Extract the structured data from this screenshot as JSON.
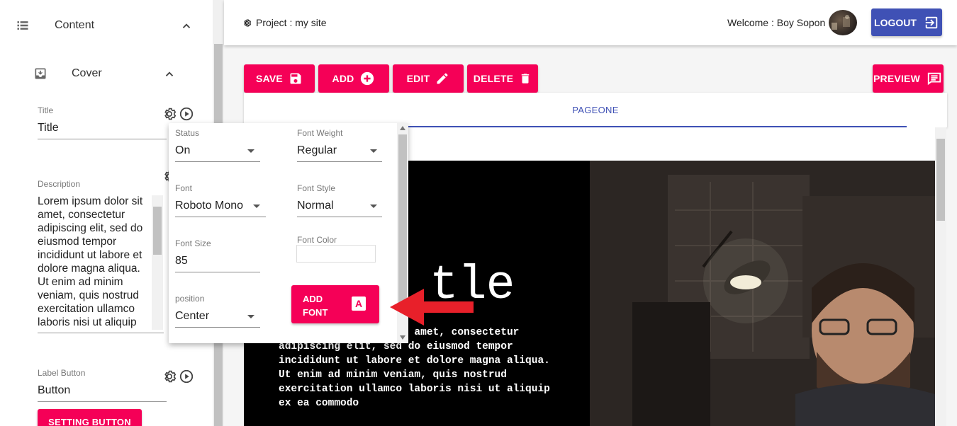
{
  "header": {
    "project_label": "Project : my site",
    "welcome_label": "Welcome : Boy Sopon",
    "logout_label": "LOGOUT"
  },
  "sidebar": {
    "content_label": "Content",
    "cover_label": "Cover",
    "title_field": {
      "label": "Title",
      "value": "Title"
    },
    "description_field": {
      "label": "Description",
      "value": "Lorem ipsum dolor sit amet, consectetur adipiscing elit, sed do eiusmod tempor incididunt ut labore et dolore magna aliqua. Ut enim ad minim veniam, quis nostrud exercitation ullamco laboris nisi ut aliquip"
    },
    "button_field": {
      "label": "Label Button",
      "value": "Button"
    },
    "setting_button_label": "SETTING BUTTON"
  },
  "toolbar": {
    "save_label": "SAVE",
    "add_label": "ADD",
    "edit_label": "EDIT",
    "delete_label": "DELETE",
    "preview_label": "PREVIEW"
  },
  "tabs": [
    {
      "label": "PAGEONE"
    }
  ],
  "font_popup": {
    "status": {
      "label": "Status",
      "value": "On"
    },
    "font_weight": {
      "label": "Font Weight",
      "value": "Regular"
    },
    "font": {
      "label": "Font",
      "value": "Roboto Mono"
    },
    "font_style": {
      "label": "Font Style",
      "value": "Normal"
    },
    "font_size": {
      "label": "Font Size",
      "value": "85"
    },
    "font_color": {
      "label": "Font Color",
      "value": ""
    },
    "position": {
      "label": "position",
      "value": "Center"
    },
    "add_font_label": "ADD FONT",
    "add_font_icon": "A"
  },
  "preview": {
    "cover_title": "tle",
    "cover_description": "Lorem ipsum dolor sit amet, consectetur adipiscing elit, sed do eiusmod tempor incididunt ut labore et dolore magna aliqua. Ut enim ad minim veniam, quis nostrud exercitation ullamco laboris nisi ut aliquip ex ea commodo"
  },
  "colors": {
    "accent_pink": "#f50057",
    "primary_indigo": "#3f51b5",
    "annotation_red": "#e8202a"
  }
}
